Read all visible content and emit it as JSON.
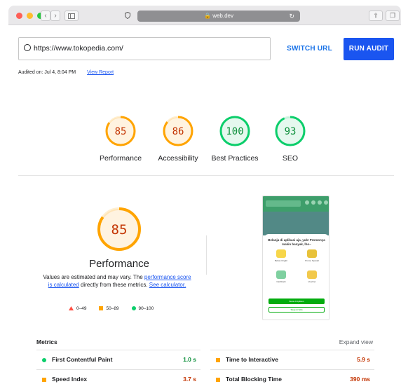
{
  "browser": {
    "address": "web.dev",
    "lock_icon": "lock-icon",
    "traffic_lights": [
      "#fe5f57",
      "#febc2e",
      "#28c840"
    ]
  },
  "audit": {
    "url": "https://www.tokopedia.com/",
    "switch_label": "SWITCH URL",
    "run_label": "RUN AUDIT",
    "audited_on": "Audited on: Jul 4, 8:04 PM",
    "view_report": "View Report"
  },
  "scores": [
    {
      "label": "Performance",
      "value": "85",
      "status": "average"
    },
    {
      "label": "Accessibility",
      "value": "86",
      "status": "average"
    },
    {
      "label": "Best Practices",
      "value": "100",
      "status": "pass"
    },
    {
      "label": "SEO",
      "value": "93",
      "status": "pass"
    }
  ],
  "colors": {
    "pass": "#0cce6b",
    "pass_text": "#0c8f3a",
    "average": "#ffa400",
    "average_text": "#c33300",
    "fail": "#ff4e42",
    "accent": "#1a55f0"
  },
  "performance": {
    "score": "85",
    "title": "Performance",
    "desc_before": "Values are estimated and may vary. The ",
    "desc_link1": "performance score is calculated",
    "desc_middle": " directly from these metrics. ",
    "desc_link2": "See calculator."
  },
  "legend": [
    {
      "range": "0–49",
      "shape": "triangle"
    },
    {
      "range": "50–89",
      "shape": "square"
    },
    {
      "range": "90–100",
      "shape": "circle"
    }
  ],
  "screenshot": {
    "heading": "Belanja di aplikasi aja, yuk! Promonya makin banyak, lho~",
    "features": [
      "Bebas Ongkir",
      "Promo Spesial",
      "Cashback",
      "Voucher"
    ],
    "primary_button": "Buka di Aplikasi",
    "secondary_button": "Tetap di Web"
  },
  "metrics": {
    "title": "Metrics",
    "expand": "Expand view",
    "items": [
      {
        "name": "First Contentful Paint",
        "value": "1.0 s",
        "status": "pass"
      },
      {
        "name": "Time to Interactive",
        "value": "5.9 s",
        "status": "average"
      },
      {
        "name": "Speed Index",
        "value": "3.7 s",
        "status": "average"
      },
      {
        "name": "Total Blocking Time",
        "value": "390 ms",
        "status": "average"
      }
    ]
  }
}
